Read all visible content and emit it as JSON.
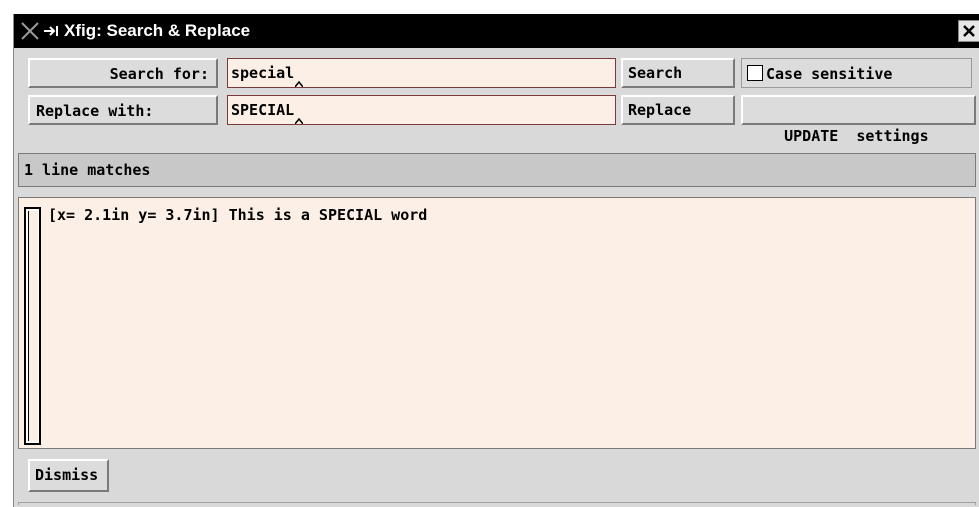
{
  "window": {
    "title": "Xfig: Search & Replace",
    "close_icon": "close-icon"
  },
  "search_row": {
    "label": "Search for:",
    "value": "special",
    "button": "Search",
    "checkbox_label": "Case sensitive",
    "case_sensitive": false
  },
  "replace_row": {
    "label": "Replace with:",
    "value": "SPECIAL",
    "button": "Replace",
    "update_button": "UPDATE  settings"
  },
  "status": {
    "text": "1 line matches"
  },
  "results": {
    "lines": [
      "[x= 2.1in y= 3.7in] This is a SPECIAL word"
    ]
  },
  "footer": {
    "dismiss_label": "Dismiss"
  },
  "colors": {
    "field_bg": "#fcefe6",
    "panel_bg": "#d9d9d9",
    "titlebar_bg": "#000000"
  }
}
